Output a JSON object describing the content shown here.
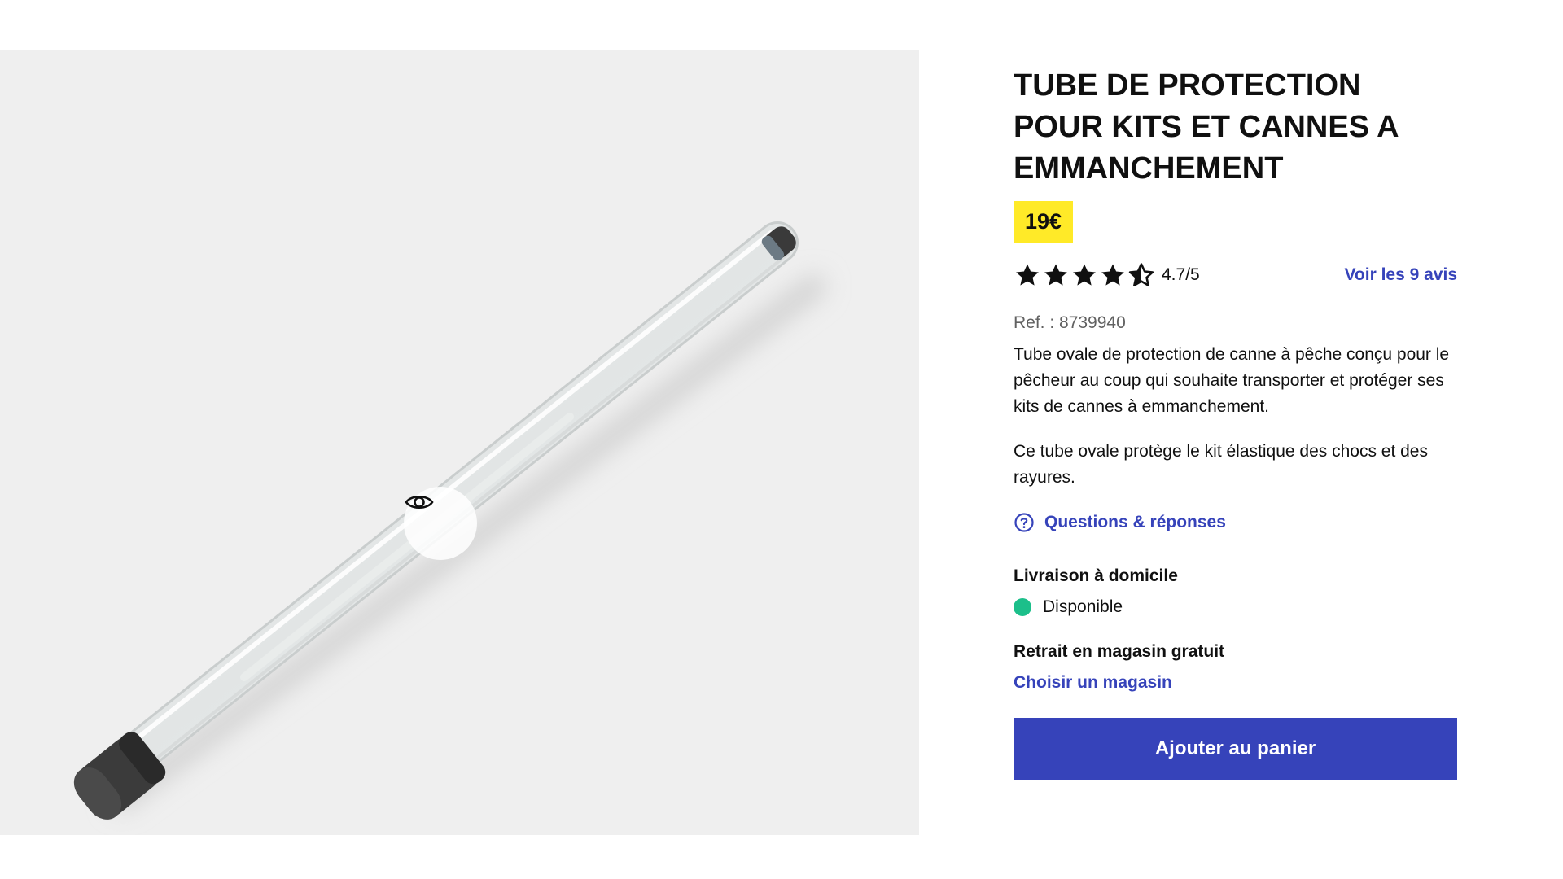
{
  "product": {
    "title": "TUBE DE PROTECTION POUR KITS ET CANNES A EMMANCHEMENT",
    "price": "19€",
    "rating": {
      "value": 4.7,
      "label": "4.7/5",
      "stars_full": 4,
      "stars_half": 1,
      "reviews_link": "Voir les 9 avis"
    },
    "reference": "Ref. : 8739940",
    "description": [
      "Tube ovale de protection de canne à pêche conçu pour le pêcheur au coup qui souhaite transporter et protéger ses kits de cannes à emmanchement.",
      "Ce tube ovale protège le kit élastique des chocs et des rayures."
    ],
    "qa_link": "Questions & réponses",
    "delivery": {
      "title": "Livraison à domicile",
      "status": "Disponible"
    },
    "pickup": {
      "title": "Retrait en magasin gratuit",
      "link": "Choisir un magasin"
    },
    "add_to_cart": "Ajouter au panier"
  },
  "gallery": {
    "zoom_icon": "eye-icon",
    "image": "transparent-tube-product-photo"
  },
  "colors": {
    "accent": "#3643ba",
    "price_bg": "#ffea28",
    "available": "#1cbf8a",
    "gallery_bg": "#efefef"
  }
}
